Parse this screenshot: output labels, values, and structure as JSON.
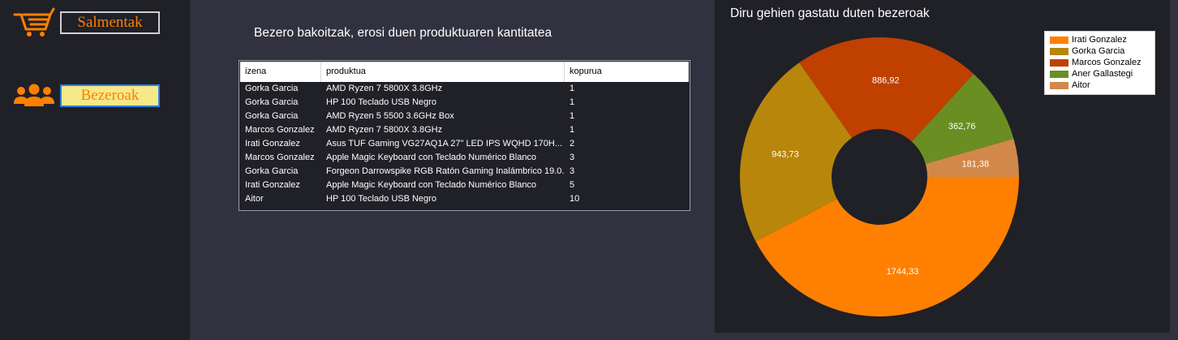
{
  "sidebar": {
    "items": [
      {
        "label": "Salmentak",
        "icon": "shopping-cart-icon"
      },
      {
        "label": "Bezeroak",
        "icon": "users-icon"
      }
    ]
  },
  "table": {
    "title": "Bezero bakoitzak, erosi duen produktuaren kantitatea",
    "columns": [
      "izena",
      "produktua",
      "kopurua"
    ],
    "rows": [
      [
        "Gorka Garcia",
        "AMD Ryzen 7 5800X 3.8GHz",
        "1"
      ],
      [
        "Gorka Garcia",
        "HP 100 Teclado USB Negro",
        "1"
      ],
      [
        "Gorka Garcia",
        "AMD Ryzen 5 5500 3.6GHz Box",
        "1"
      ],
      [
        "Marcos Gonzalez",
        "AMD Ryzen 7 5800X 3.8GHz",
        "1"
      ],
      [
        "Irati Gonzalez",
        "Asus TUF Gaming VG27AQ1A 27\" LED IPS WQHD 170H...",
        "2"
      ],
      [
        "Marcos Gonzalez",
        "Apple Magic Keyboard con Teclado Numérico Blanco",
        "3"
      ],
      [
        "Gorka Garcia",
        "Forgeon Darrowspike RGB Ratón Gaming Inalámbrico 19.0...",
        "3"
      ],
      [
        "Irati Gonzalez",
        "Apple Magic Keyboard con Teclado Numérico Blanco",
        "5"
      ],
      [
        "Aitor",
        "HP 100 Teclado USB Negro",
        "10"
      ]
    ]
  },
  "chart_panel": {
    "title": "Diru gehien gastatu duten bezeroak"
  },
  "chart_data": {
    "type": "pie",
    "variant": "doughnut",
    "title": "Diru gehien gastatu duten bezeroak",
    "legend_position": "top-right",
    "categories": [
      "Irati Gonzalez",
      "Gorka Garcia",
      "Marcos Gonzalez",
      "Aner Gallastegi",
      "Aitor"
    ],
    "values": [
      1744.33,
      943.73,
      886.92,
      362.76,
      181.38
    ],
    "value_labels": [
      "1744,33",
      "943,73",
      "886,92",
      "362,76",
      "181,38"
    ],
    "colors": [
      "#ff8000",
      "#b8860b",
      "#c04000",
      "#6b8e23",
      "#d2884a"
    ]
  }
}
